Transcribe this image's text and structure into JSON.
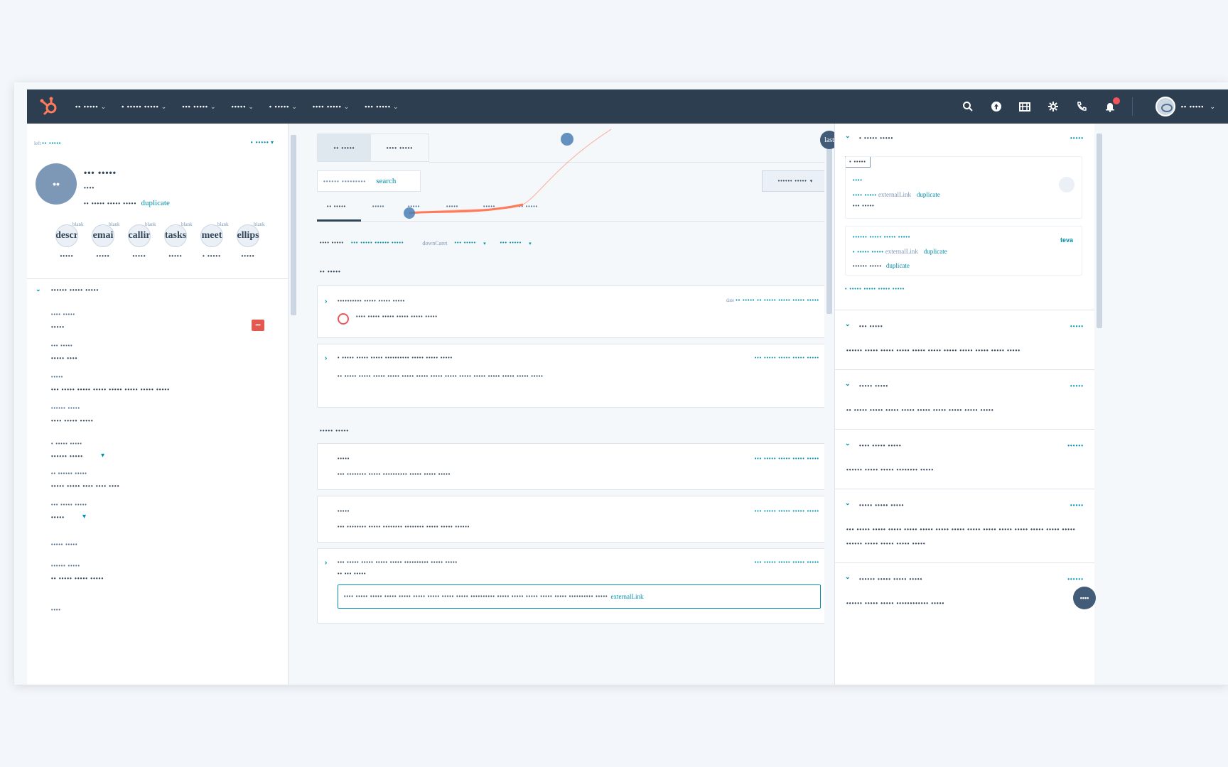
{
  "topbar": {
    "nav": [
      "•• •••••",
      "• ••••• •••••",
      "••• •••••",
      "•••••",
      "• •••••",
      "•••• •••••",
      "••• •••••"
    ],
    "account_label": "•• •••••"
  },
  "left": {
    "back_link": "•• •••••",
    "back_prefix": "left",
    "actions_label": "• •••••",
    "avatar_initials": "••",
    "name": "••• •••••",
    "subtitle": "••••",
    "email_line": "•• ••••• ••••• •••••",
    "duplicate_label": "duplicate",
    "comm_buttons": [
      {
        "glyph": "descr",
        "label": "•••••",
        "hint": "blank"
      },
      {
        "glyph": "emai",
        "label": "•••••",
        "hint": "blank"
      },
      {
        "glyph": "callir",
        "label": "•••••",
        "hint": "blank"
      },
      {
        "glyph": "tasks",
        "label": "•••••",
        "hint": "blank"
      },
      {
        "glyph": "meet",
        "label": "• •••••",
        "hint": "blank"
      },
      {
        "glyph": "ellips",
        "label": "•••••",
        "hint": "blank"
      }
    ],
    "about_title": "•••••• ••••• •••••",
    "properties": [
      {
        "label": "•••• •••••",
        "value": "•••••"
      },
      {
        "label": "••• •••••",
        "value": "••••• ••••"
      },
      {
        "label": "•••••",
        "value": "••• ••••• ••••• ••••• ••••• ••••• ••••• •••••"
      },
      {
        "label": "•••••• •••••",
        "value": "•••• ••••• •••••"
      },
      {
        "label": "• ••••• •••••",
        "value": "•••••• •••••"
      },
      {
        "label": "•• •••••• •••••",
        "value": "••••• ••••• •••• •••• ••••"
      },
      {
        "label": "••• ••••• •••••",
        "value": "•••••"
      },
      {
        "label": "••••• •••••",
        "value": ""
      },
      {
        "label": "•••••• •••••",
        "value": "•• ••••• ••••• •••••"
      },
      {
        "label": "••••",
        "value": ""
      }
    ]
  },
  "mid": {
    "tabs": [
      "•• •••••",
      "•••• •••••"
    ],
    "search_placeholder": "•••••• •••••••••",
    "search_label": "search",
    "filter_label": "•••••• •••••",
    "activity_tabs": [
      "•• •••••",
      "•••••",
      "•••••",
      "•••••",
      "•••••",
      "•• •••••"
    ],
    "filter_row": {
      "label": "•••• •••••",
      "link": "••• ••••• •••••• •••••",
      "hint": "downCaret",
      "dd1": "••• •••••",
      "dd2": "••• •••••"
    },
    "section1": "•• •••••",
    "card1": {
      "title": "•••••••••• ••••• ••••• •••••",
      "date_prefix": "date",
      "date": "•• ••••• •• ••••• ••••• ••••• •••••",
      "body": "•••• ••••• ••••• ••••• ••••• •••••"
    },
    "card2": {
      "title": "• ••••• ••••• ••••• •••••••••• ••••• ••••• •••••",
      "date": "••• ••••• ••••• ••••• •••••",
      "body": "•• ••••• ••••• ••••• ••••• ••••• ••••• ••••• ••••• ••••• ••••• ••••• ••••• ••••• •••••"
    },
    "section2": "••••• •••••",
    "card3": {
      "title": "•••••",
      "date": "••• ••••• ••••• ••••• •••••",
      "body": "••• •••••••• ••••• •••••••••• ••••• ••••• •••••"
    },
    "card4": {
      "title": "•••••",
      "date": "••• ••••• ••••• ••••• •••••",
      "body": "••• •••••••• ••••• •••••••• •••••••• ••••• ••••• ••••••"
    },
    "card5": {
      "title": "••• ••••• ••••• ••••• ••••• •••••••••• ••••• •••••",
      "sub": "•• ••• •••••",
      "date": "••• ••••• ••••• ••••• •••••",
      "quote": "•••• ••••• ••••• ••••• ••••• ••••• ••••• •••••      ••••• •••••••••• ••••• ••••• ••••• ••••• ••••• •••••••••• •••••",
      "quote_link": "externalLink"
    }
  },
  "right": {
    "sections": [
      {
        "title": "• ••••• •••••",
        "link": "•••••"
      },
      {
        "title": "••• •••••",
        "link": "•••••",
        "text": "•••••• ••••• ••••• ••••• ••••• ••••• ••••• ••••• ••••• ••••• •••••"
      },
      {
        "title": "••••• •••••",
        "link": "•••••",
        "text": "•• ••••• ••••• ••••• ••••• ••••• ••••• ••••• ••••• •••••"
      },
      {
        "title": "•••• ••••• •••••",
        "link": "••••••",
        "text": "•••••• ••••• ••••• •••••••• •••••"
      },
      {
        "title": "••••• ••••• •••••",
        "link": "•••••",
        "text": "••• ••••• ••••• ••••• ••••• ••••• ••••• ••••• ••••• ••••• ••••• ••••• ••••• ••••• •••••",
        "text2": "•••••• ••••• ••••• ••••• •••••"
      },
      {
        "title": "•••••• ••••• ••••• •••••",
        "link": "••••••",
        "text": "•••••• ••••• ••••• •••••••••••• •••••"
      }
    ],
    "badge": "• •••••",
    "box1": {
      "line1": "••••",
      "line2_a": "•••• •••••",
      "line2_link": "externalLink",
      "line2_dup": "duplicate",
      "line3": "••• •••••"
    },
    "box2": {
      "line1": "•••••• ••••• ••••• •••••",
      "brand": "teva",
      "line2_a": "• ••••• •••••",
      "line2_link": "externalLink",
      "line2_dup": "duplicate",
      "line3": "•••••• •••••",
      "line3_dup": "duplicate"
    },
    "view_all": "• ••••• ••••• ••••• •••••"
  },
  "overlay": {
    "badge": "last"
  },
  "help_label": "••••"
}
